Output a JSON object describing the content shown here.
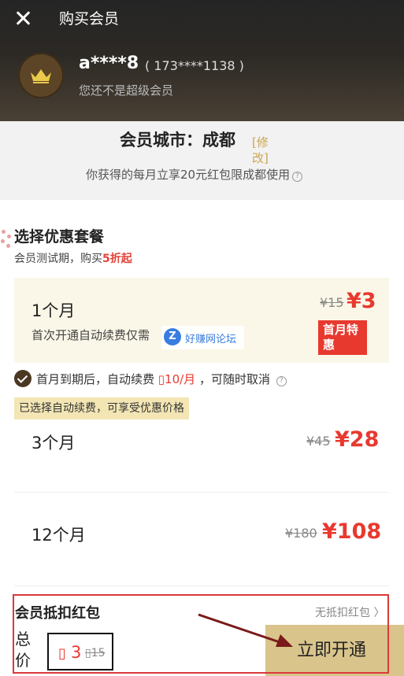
{
  "header": {
    "title": "购买会员",
    "user_name": "a****8",
    "user_phone": "( 173****1138 )",
    "user_status": "您还不是超级会员"
  },
  "city": {
    "label": "会员城市：成都",
    "edit": "[修改]",
    "note": "你获得的每月立享20元红包限成都使用"
  },
  "plans_section": {
    "title": "选择优惠套餐",
    "subtitle_prefix": "会员测试期，购买",
    "subtitle_highlight": "5折起"
  },
  "plans": [
    {
      "name": "1个月",
      "desc": "首次开通自动续费仅需",
      "old_price": "¥15",
      "new_price": "¥3",
      "badge": "首月特惠"
    },
    {
      "name": "3个月",
      "old_price": "¥45",
      "new_price": "¥28"
    },
    {
      "name": "12个月",
      "old_price": "¥180",
      "new_price": "¥108"
    }
  ],
  "watermark": {
    "icon": "Z",
    "text": "好赚网论坛"
  },
  "renew": {
    "text_before": "首月到期后，自动续费 ",
    "price": "▯10/月",
    "text_after": " ，可随时取消"
  },
  "tip": "已选择自动续费，可享受优惠价格",
  "red_packet": {
    "label": "会员抵扣红包",
    "value": "无抵扣红包 〉"
  },
  "total": {
    "label": "总价",
    "currency": "▯",
    "price": "3",
    "old_price": "▯15"
  },
  "open_button": "立即开通",
  "colors": {
    "accent_red": "#e8392f",
    "gold": "#c9a652",
    "annotation_red": "#d93a3a",
    "button_gold": "#d9c48c"
  },
  "icons": {
    "close": "close-icon",
    "crown": "crown-icon",
    "help": "help-icon",
    "check": "check-icon",
    "chevron": "chevron-right-icon",
    "annotation_arrow": "arrow-icon"
  }
}
